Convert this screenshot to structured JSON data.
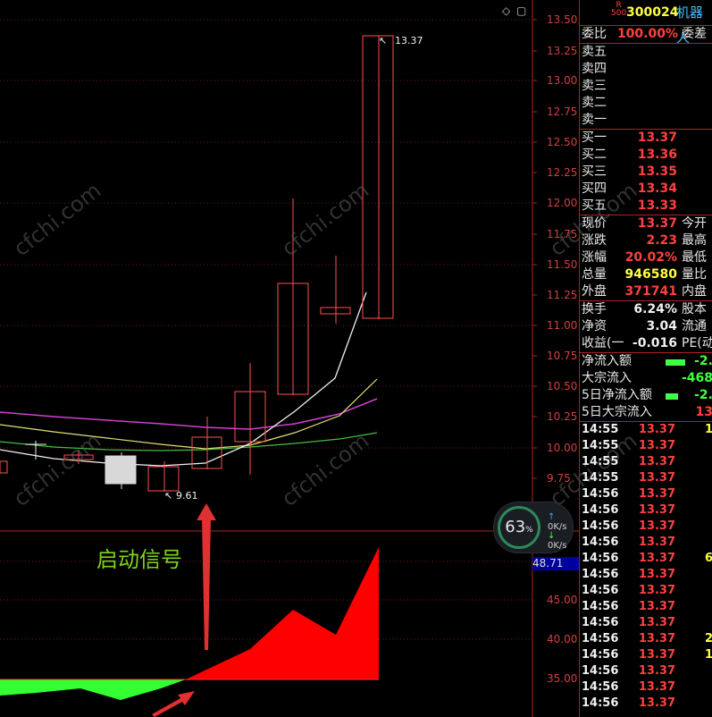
{
  "watermark": "cfchi.com",
  "price_axis": {
    "ticks": [
      "13.50",
      "13.25",
      "13.00",
      "12.75",
      "12.50",
      "12.25",
      "12.00",
      "11.75",
      "11.50",
      "11.25",
      "11.00",
      "10.75",
      "10.50",
      "10.25",
      "10.00",
      "9.75"
    ]
  },
  "indicator_axis": {
    "ticks": [
      "45.00",
      "40.00",
      "35.00"
    ],
    "current": "48.71"
  },
  "annotations": {
    "high": "13.37",
    "low": "9.61",
    "signal_text": "启动信号"
  },
  "gauge": {
    "percent": "63",
    "percent_unit": "%",
    "upload": "0K/s",
    "download": "0K/s"
  },
  "panel": {
    "r_mark": "R",
    "r_sub": "500",
    "code": "300024",
    "name": "机器人",
    "ratio_label": "委比",
    "ratio_value": "100.00%",
    "diff_label": "委差",
    "asks": [
      {
        "label": "卖五"
      },
      {
        "label": "卖四"
      },
      {
        "label": "卖三"
      },
      {
        "label": "卖二"
      },
      {
        "label": "卖一"
      }
    ],
    "bids": [
      {
        "label": "买一",
        "price": "13.37"
      },
      {
        "label": "买二",
        "price": "13.36"
      },
      {
        "label": "买三",
        "price": "13.35"
      },
      {
        "label": "买四",
        "price": "13.34"
      },
      {
        "label": "买五",
        "price": "13.33"
      }
    ],
    "quote": [
      {
        "l1": "现价",
        "v": "13.37",
        "l2": "今开"
      },
      {
        "l1": "涨跌",
        "v": "2.23",
        "l2": "最高"
      },
      {
        "l1": "涨幅",
        "v": "20.02%",
        "l2": "最低"
      },
      {
        "l1": "总量",
        "v": "946580",
        "l2": "量比"
      },
      {
        "l1": "外盘",
        "v": "371741",
        "l2": "内盘"
      }
    ],
    "fin": [
      {
        "l1": "换手",
        "v": "6.24%",
        "l2": "股本"
      },
      {
        "l1": "净资",
        "v": "3.04",
        "l2": "流通"
      },
      {
        "l1": "收益(一",
        "v": "-0.016",
        "l2": "PE(动"
      }
    ],
    "flow": [
      {
        "label": "净流入额",
        "value": "-2."
      },
      {
        "label": "大宗流入",
        "value": "-468"
      },
      {
        "label": "5日净流入额",
        "value": "-2."
      },
      {
        "label": "5日大宗流入",
        "value": "13"
      }
    ],
    "ticks": [
      {
        "time": "14:55",
        "price": "13.37",
        "vol": "1"
      },
      {
        "time": "14:55",
        "price": "13.37",
        "vol": ""
      },
      {
        "time": "14:55",
        "price": "13.37",
        "vol": ""
      },
      {
        "time": "14:55",
        "price": "13.37",
        "vol": ""
      },
      {
        "time": "14:56",
        "price": "13.37",
        "vol": ""
      },
      {
        "time": "14:56",
        "price": "13.37",
        "vol": ""
      },
      {
        "time": "14:56",
        "price": "13.37",
        "vol": ""
      },
      {
        "time": "14:56",
        "price": "13.37",
        "vol": ""
      },
      {
        "time": "14:56",
        "price": "13.37",
        "vol": "6"
      },
      {
        "time": "14:56",
        "price": "13.37",
        "vol": ""
      },
      {
        "time": "14:56",
        "price": "13.37",
        "vol": ""
      },
      {
        "time": "14:56",
        "price": "13.37",
        "vol": ""
      },
      {
        "time": "14:56",
        "price": "13.37",
        "vol": ""
      },
      {
        "time": "14:56",
        "price": "13.37",
        "vol": "2"
      },
      {
        "time": "14:56",
        "price": "13.37",
        "vol": "1"
      },
      {
        "time": "14:56",
        "price": "13.37",
        "vol": ""
      },
      {
        "time": "14:56",
        "price": "13.37",
        "vol": ""
      },
      {
        "time": "14:56",
        "price": "13.37",
        "vol": ""
      }
    ]
  }
}
